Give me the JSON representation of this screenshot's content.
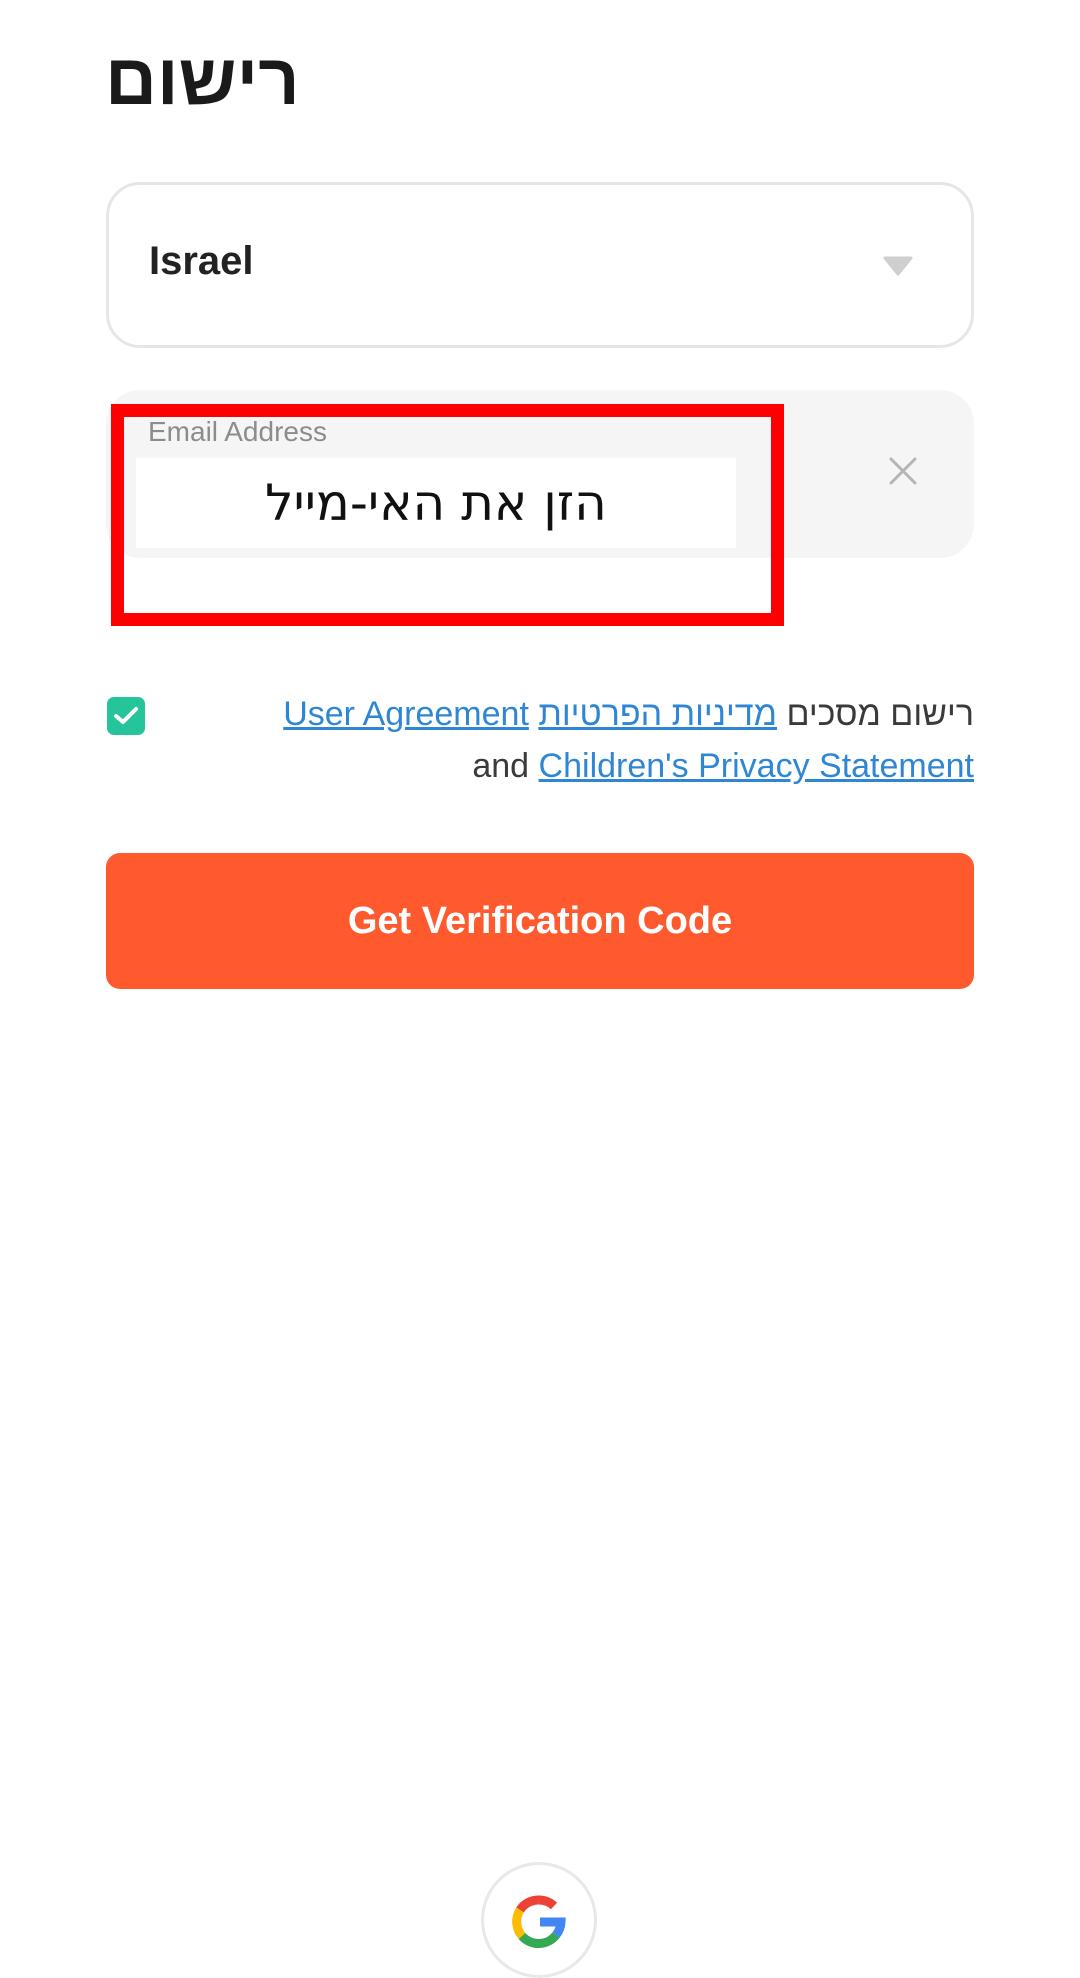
{
  "header": {
    "title": "רישום"
  },
  "country_select": {
    "value": "Israel",
    "icon": "caret-down-icon"
  },
  "email_field": {
    "label": "Email Address",
    "value": "הזן את האי-מייל",
    "clear_icon": "close-icon"
  },
  "agreement": {
    "checked": true,
    "prefix": "רישום מסכים",
    "privacy_policy_link": "מדיניות הפרטיות",
    "user_agreement_link": "User Agreement",
    "and_text": "and",
    "childrens_privacy_link": "Children's Privacy Statement"
  },
  "verify_button": {
    "label": "Get Verification Code"
  },
  "colors": {
    "accent_button": "#ff5a2d",
    "checkbox": "#25c49a",
    "link": "#2f86d4",
    "annotation_box": "#ff0000"
  },
  "social_login": {
    "icon": "google-icon"
  }
}
